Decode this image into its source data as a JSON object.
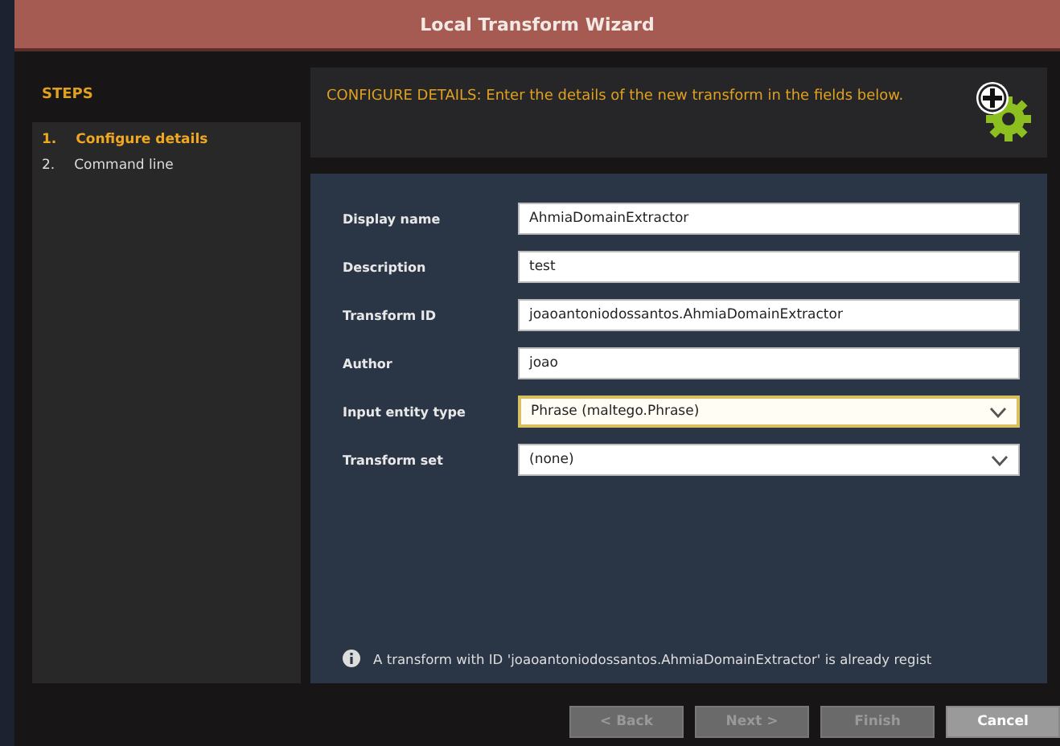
{
  "window": {
    "title": "Local Transform Wizard"
  },
  "steps": {
    "title": "STEPS",
    "items": [
      {
        "number": "1.",
        "label": "Configure details",
        "selected": true
      },
      {
        "number": "2.",
        "label": "Command line",
        "selected": false
      }
    ]
  },
  "header": {
    "text": "CONFIGURE DETAILS: Enter the details of the new transform in the fields below."
  },
  "fields": [
    {
      "kind": "text",
      "label": "Display name",
      "value": "AhmiaDomainExtractor",
      "focused": false
    },
    {
      "kind": "text",
      "label": "Description",
      "value": "test",
      "focused": false
    },
    {
      "kind": "text",
      "label": "Transform ID",
      "value": "joaoantoniodossantos.AhmiaDomainExtractor",
      "focused": false
    },
    {
      "kind": "text",
      "label": "Author",
      "value": "joao",
      "focused": false
    },
    {
      "kind": "dropdown",
      "label": "Input entity type",
      "value": "Phrase (maltego.Phrase)",
      "focused": true
    },
    {
      "kind": "dropdown",
      "label": "Transform set",
      "value": "(none)",
      "focused": false
    }
  ],
  "message": {
    "text": "A transform with ID 'joaoantoniodossantos.AhmiaDomainExtractor' is already regist"
  },
  "buttons": [
    {
      "label": "< Back",
      "disabled": true
    },
    {
      "label": "Next >",
      "disabled": true
    },
    {
      "label": "Finish",
      "disabled": true
    },
    {
      "label": "Cancel",
      "disabled": false
    }
  ]
}
